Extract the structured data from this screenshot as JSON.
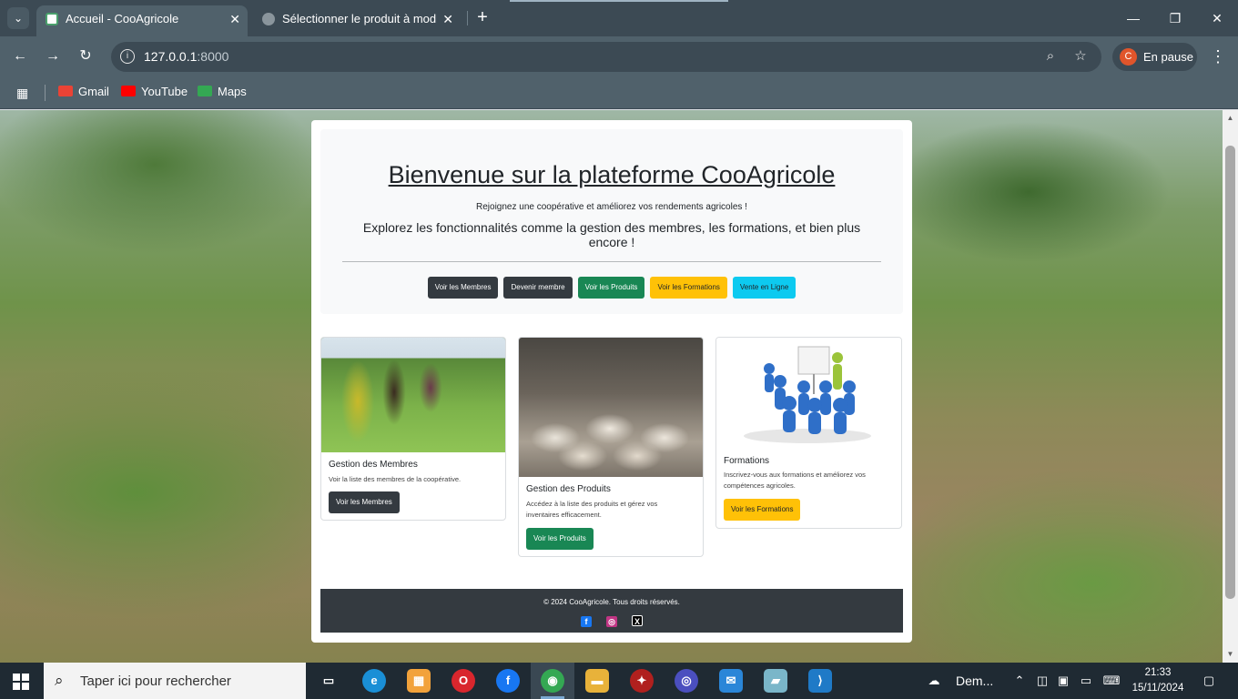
{
  "browser": {
    "tabs": [
      {
        "label": "Accueil - CooAgricole",
        "close": "✕"
      },
      {
        "label": "Sélectionner le produit à modifier",
        "close": "✕"
      }
    ],
    "new_tab": "+",
    "url_host": "127.0.0.1",
    "url_port": ":8000",
    "profile_initial": "C",
    "profile_label": "En pause",
    "bookmarks": [
      "Gmail",
      "YouTube",
      "Maps"
    ],
    "win_controls": {
      "minimize": "—",
      "restore": "❐",
      "close": "✕"
    }
  },
  "hero": {
    "title": "Bienvenue sur la plateforme CooAgricole",
    "lead": "Rejoignez une coopérative et améliorez vos rendements agricoles !",
    "text": "Explorez les fonctionnalités comme la gestion des membres, les formations, et bien plus encore !",
    "buttons": [
      "Voir les Membres",
      "Devenir membre",
      "Voir les Produits",
      "Voir les Formations",
      "Vente en Ligne"
    ]
  },
  "cards": [
    {
      "title": "Gestion des Membres",
      "text": "Voir la liste des membres de la coopérative.",
      "button": "Voir les Membres"
    },
    {
      "title": "Gestion des Produits",
      "text": "Accédez à la liste des produits et gérez vos inventaires efficacement.",
      "button": "Voir les Produits"
    },
    {
      "title": "Formations",
      "text": "Inscrivez-vous aux formations et améliorez vos compétences agricoles.",
      "button": "Voir les Formations"
    }
  ],
  "footer": {
    "text": "© 2024 CooAgricole. Tous droits réservés.",
    "social_icons": [
      "facebook-icon",
      "instagram-icon",
      "x-icon"
    ]
  },
  "taskbar": {
    "search_placeholder": "Taper ici pour rechercher",
    "weather_label": "Dem...",
    "time": "21:33",
    "date": "15/11/2024"
  },
  "colors": {
    "dark": "#343a40",
    "success": "#198754",
    "warning": "#ffc107",
    "info": "#0dcaf0",
    "chrome": "#50616b"
  }
}
